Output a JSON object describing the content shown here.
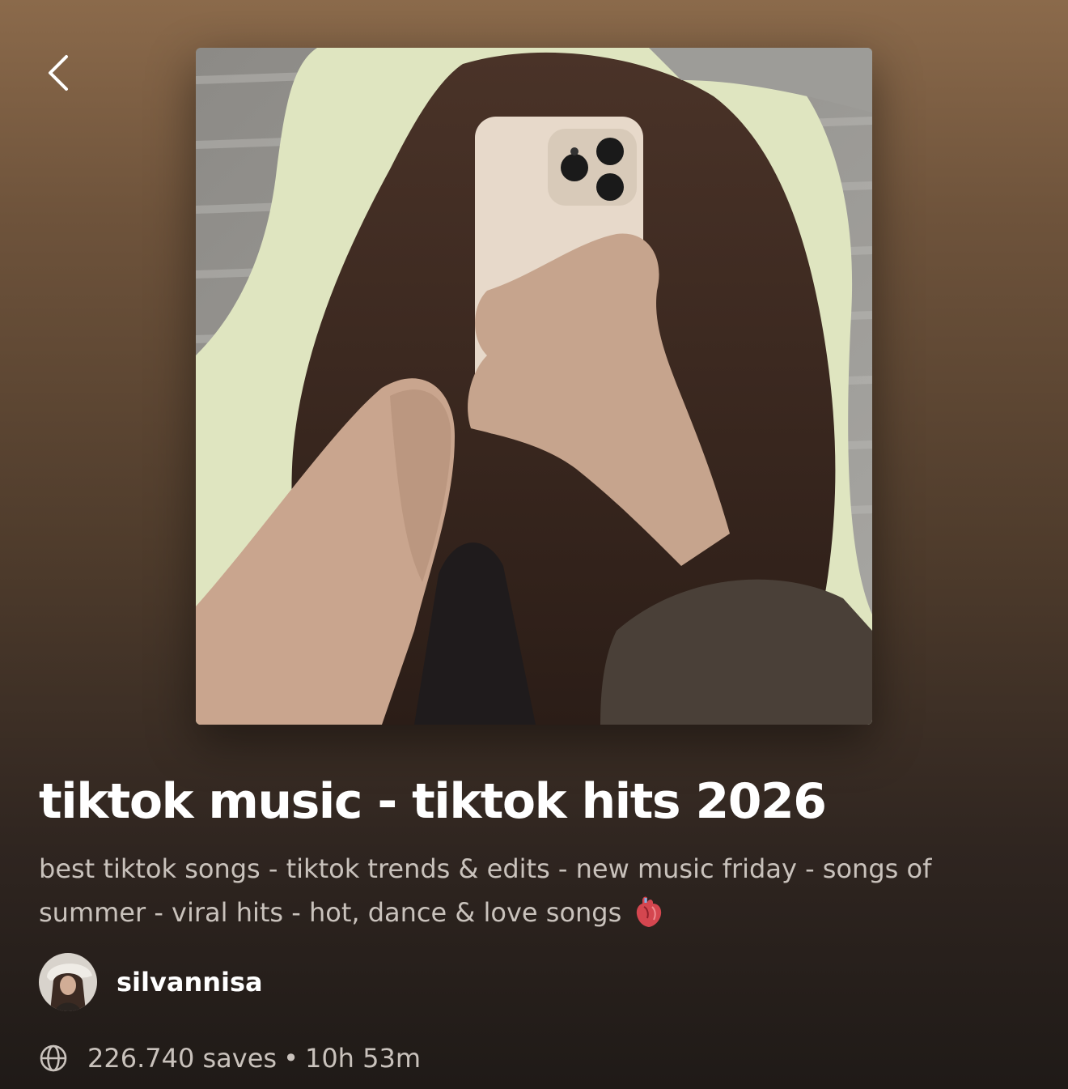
{
  "header": {
    "back_icon": "chevron-left-icon"
  },
  "playlist": {
    "cover_alt": "Playlist cover image",
    "title": "tiktok music - tiktok hits 2026",
    "description": "best tiktok songs - tiktok trends & edits - new music friday - songs of summer - viral hits - hot, dance & love songs",
    "description_icon": "anatomical-heart-icon",
    "owner": {
      "name": "silvannisa",
      "avatar_icon": "avatar"
    },
    "visibility_icon": "globe-icon",
    "saves": "226.740 saves",
    "separator": "•",
    "duration": "10h 53m"
  },
  "colors": {
    "background_top": "#8b6a4b",
    "background_bottom": "#1f1a17",
    "title": "#ffffff",
    "secondary_text": "#c9c2bc"
  }
}
